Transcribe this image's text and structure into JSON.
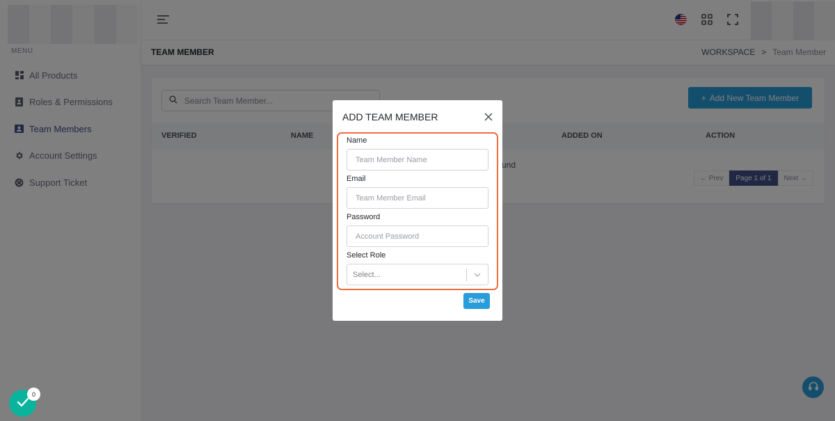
{
  "sidebar": {
    "menu_title": "MENU",
    "items": [
      {
        "label": "All Products",
        "icon": "grid-icon"
      },
      {
        "label": "Roles & Permissions",
        "icon": "id-badge-icon"
      },
      {
        "label": "Team Members",
        "icon": "team-icon"
      },
      {
        "label": "Account Settings",
        "icon": "gear-icon"
      },
      {
        "label": "Support Ticket",
        "icon": "lifebuoy-icon"
      }
    ],
    "active_item": "Team Members"
  },
  "page": {
    "title": "TEAM MEMBER",
    "breadcrumb": {
      "parent": "WORKSPACE",
      "separator": ">",
      "current": "Team Member"
    }
  },
  "toolbar": {
    "search_placeholder": "Search Team Member...",
    "add_button_label": "Add New Team Member",
    "add_button_prefix": "+"
  },
  "table": {
    "columns": [
      "VERIFIED",
      "NAME",
      "ADDED ON",
      "ACTION"
    ],
    "empty_text_visible": "und"
  },
  "pagination": {
    "prev": "← Prev",
    "current": "Page 1 of 1",
    "next": "Next →"
  },
  "modal": {
    "title": "ADD TEAM MEMBER",
    "fields": {
      "name": {
        "label": "Name",
        "placeholder": "Team Member Name",
        "value": ""
      },
      "email": {
        "label": "Email",
        "placeholder": "Team Member Email",
        "value": ""
      },
      "password": {
        "label": "Password",
        "placeholder": "Account Password",
        "value": ""
      },
      "role": {
        "label": "Select Role",
        "placeholder": "Select..."
      }
    },
    "save_label": "Save"
  },
  "widgets": {
    "notification_count": "0"
  },
  "colors": {
    "primary": "#405189",
    "info": "#299cdb",
    "success": "#0ab39c",
    "highlight": "#f06c3d"
  }
}
